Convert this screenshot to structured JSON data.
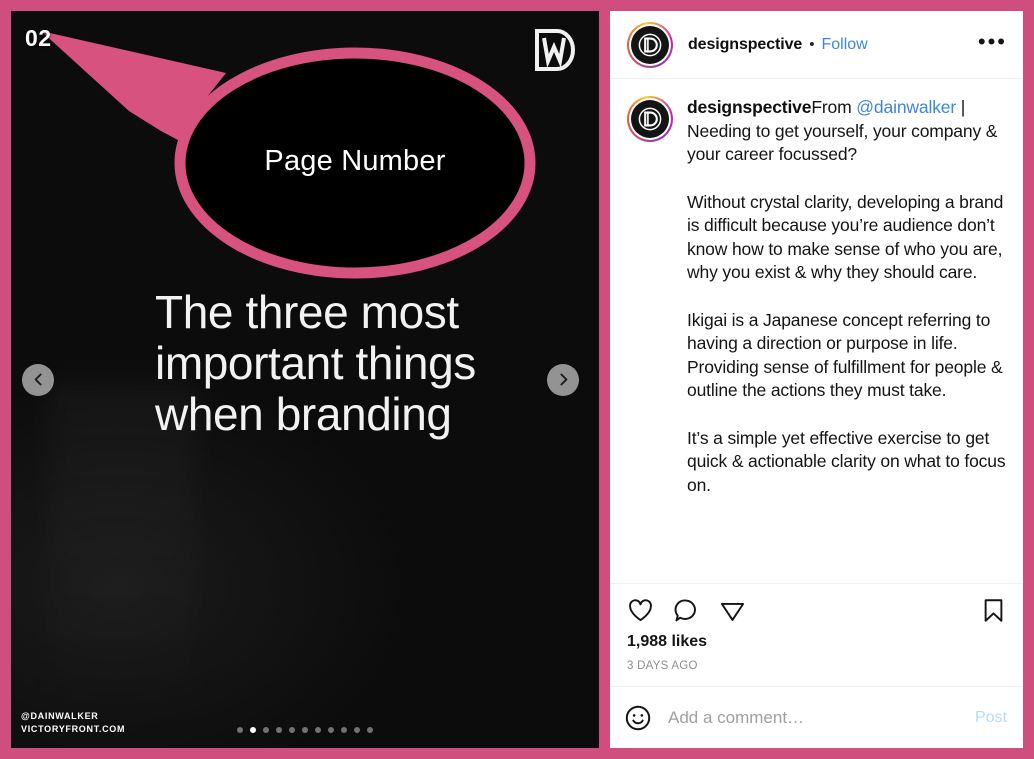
{
  "theme": {
    "frame_color": "#cf4e7e",
    "annotation_color": "#d8527f",
    "link_color": "#3d87da",
    "post_button_color": "#b2dbfb",
    "media_background": "#111111"
  },
  "media": {
    "page_number": "02",
    "logo_alt": "dw-monogram",
    "annotation_label": "Page Number",
    "headline": "The three most important things when branding",
    "watermark_line1": "@DAINWALKER",
    "watermark_line2": "VICTORYFRONT.COM",
    "prev_icon": "chevron-left-icon",
    "next_icon": "chevron-right-icon",
    "carousel": {
      "total": 11,
      "active_index": 1
    }
  },
  "header": {
    "username": "designspective",
    "separator": "•",
    "follow_label": "Follow",
    "more_label": "•••"
  },
  "caption": {
    "username": "designspective",
    "intro_prefix": "From ",
    "mention": "@dainwalker",
    "intro_suffix": " | Needing to get yourself, your company & your career focussed?",
    "paragraphs": [
      "Without crystal clarity, developing a brand is difficult because you’re audience don’t know how to make sense of who you are, why you exist & why they should care.",
      "Ikigai is a Japanese concept referring to having a direction or purpose in life. Providing sense of fulfillment for people & outline the actions they must take.",
      "It’s a simple yet effective exercise to get quick & actionable clarity on what to focus on."
    ]
  },
  "actions": {
    "like_icon": "heart-icon",
    "comment_icon": "comment-bubble-icon",
    "share_icon": "share-paper-plane-icon",
    "save_icon": "bookmark-icon"
  },
  "meta": {
    "likes": "1,988 likes",
    "timestamp": "3 DAYS AGO"
  },
  "comment_box": {
    "emoji_icon": "smiley-face-icon",
    "placeholder": "Add a comment…",
    "post_label": "Post"
  }
}
